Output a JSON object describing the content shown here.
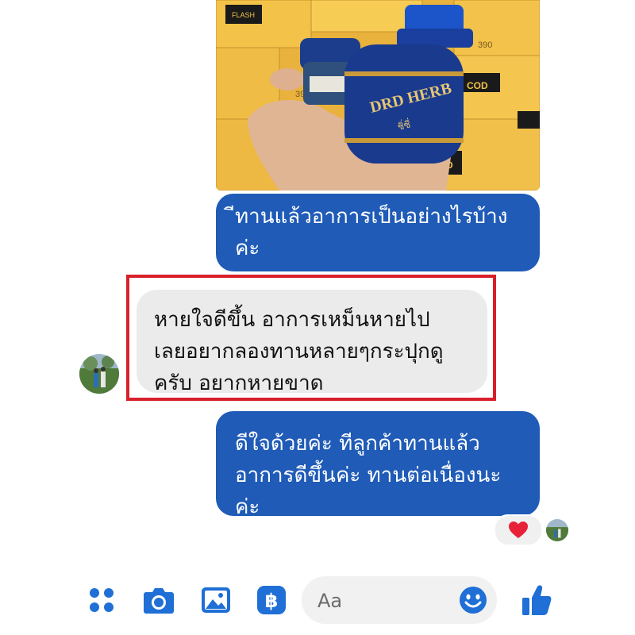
{
  "product_photo": {
    "bottle_label": "DRD HERB",
    "bottle_sublabel": "ชิ่ซี่",
    "box_brand_top": "FLASH",
    "box_brand_bottom": "COD",
    "box_price": "390"
  },
  "messages": [
    {
      "side": "outgoing",
      "lines": [
        "ีทานแล้วอาการเป็นอย่างไรบ้าง",
        "ค่ะ"
      ]
    },
    {
      "side": "incoming",
      "lines": [
        "หายใจดีขึ้น อาการเหม็นหายไป",
        "เลยอยากลองทานหลายๆกระปุกดู",
        "ครับ อยากหายขาด"
      ]
    },
    {
      "side": "outgoing",
      "lines": [
        "ดีใจด้วยค่ะ ทีลูกค้าทานแล้ว",
        "อาการดีขึ้นค่ะ ทานต่อเนื่องนะ",
        "ค่ะ"
      ]
    }
  ],
  "reaction": "heart",
  "composer": {
    "placeholder": "Aa"
  },
  "colors": {
    "outgoing_bubble": "#1f5bb7",
    "incoming_bubble": "#ebebeb",
    "highlight": "#d8202a",
    "icon": "#1f6fd6"
  },
  "toolbar_icons": [
    "menu-dots-icon",
    "camera-icon",
    "image-icon",
    "baht-icon",
    "emoji-icon",
    "thumbs-up-icon"
  ]
}
